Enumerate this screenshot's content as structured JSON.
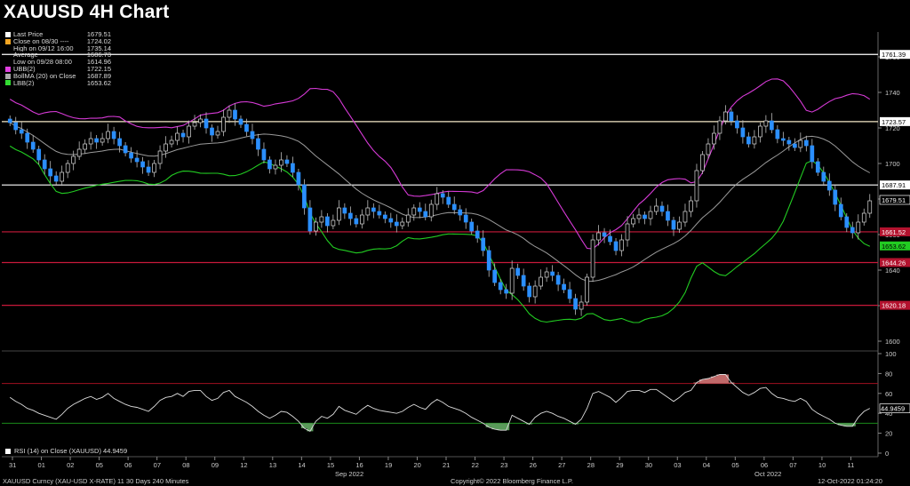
{
  "title": "XAUUSD 4H Chart",
  "legend": [
    {
      "label": "Last Price",
      "value": "1679.51",
      "color": "#ffffff"
    },
    {
      "label": "Close on 08/30 ----",
      "value": "1724.02",
      "color": "#f5a623"
    },
    {
      "label": "High on 09/12 16:00",
      "value": "1735.14",
      "color": ""
    },
    {
      "label": "Average",
      "value": "1686.73",
      "color": ""
    },
    {
      "label": "Low on 09/28 08:00",
      "value": "1614.96",
      "color": ""
    },
    {
      "label": "UBB(2)",
      "value": "1722.15",
      "color": "#e040e0"
    },
    {
      "label": "BollMA (20)  on Close",
      "value": "1687.89",
      "color": "#aaaaaa"
    },
    {
      "label": "LBB(2)",
      "value": "1653.62",
      "color": "#33dd33"
    }
  ],
  "rsi_legend": "RSI (14)  on Close (XAUUSD) 44.9459",
  "footer": {
    "left": "XAUUSD Curncy (XAU-USD X-RATE) 11 30 Days 240 Minutes",
    "center": "Copyright© 2022 Bloomberg Finance L.P.",
    "right": "12-Oct-2022 01:24:20"
  },
  "chart_data": {
    "type": "candlestick",
    "price_axis": {
      "range": [
        1596,
        1770
      ],
      "ticks": [
        "1760",
        "1740",
        "1720",
        "1700",
        "1680",
        "1660",
        "1640",
        "1620",
        "1600"
      ]
    },
    "rsi_axis": {
      "range": [
        0,
        100
      ],
      "ticks": [
        "100",
        "80",
        "60",
        "40",
        "20",
        "0"
      ],
      "overbought": 70,
      "oversold": 30
    },
    "x_ticks": [
      "31",
      "01",
      "02",
      "05",
      "06",
      "07",
      "08",
      "09",
      "12",
      "13",
      "14",
      "15",
      "16",
      "19",
      "20",
      "21",
      "22",
      "23",
      "26",
      "27",
      "28",
      "29",
      "30",
      "03",
      "04",
      "05",
      "06",
      "07",
      "10",
      "11"
    ],
    "x_months": [
      "Sep 2022",
      "Oct 2022"
    ],
    "horizontal_levels": [
      {
        "value": 1761.39,
        "label": "1761.39",
        "color": "#ffffff",
        "text": "#000000",
        "line": "#ffffff"
      },
      {
        "value": 1723.57,
        "label": "1723.57",
        "color": "#ffffff",
        "text": "#000000",
        "line": "#f5e9c8"
      },
      {
        "value": 1687.91,
        "label": "1687.91",
        "color": "#ffffff",
        "text": "#000000",
        "line": "#ffffff"
      },
      {
        "value": 1661.52,
        "label": "1661.52",
        "color": "#b3122e",
        "text": "#ffffff",
        "line": "#c8193a"
      },
      {
        "value": 1644.26,
        "label": "1644.26",
        "color": "#b3122e",
        "text": "#ffffff",
        "line": "#c8193a"
      },
      {
        "value": 1620.18,
        "label": "1620.18",
        "color": "#b3122e",
        "text": "#ffffff",
        "line": "#c8193a"
      }
    ],
    "last_price": {
      "value": 1679.51,
      "label": "1679.51"
    },
    "lbb_last": {
      "value": 1653.62,
      "label": "1653.62"
    },
    "rsi_last": {
      "value": 44.9459,
      "label": "44.9459"
    },
    "close": [
      1723,
      1719,
      1717,
      1712,
      1708,
      1702,
      1697,
      1693,
      1690,
      1695,
      1700,
      1704,
      1708,
      1711,
      1714,
      1712,
      1714,
      1718,
      1714,
      1710,
      1706,
      1703,
      1701,
      1698,
      1695,
      1700,
      1707,
      1711,
      1713,
      1717,
      1715,
      1721,
      1723,
      1725,
      1720,
      1716,
      1718,
      1726,
      1730,
      1725,
      1722,
      1718,
      1714,
      1708,
      1702,
      1697,
      1699,
      1702,
      1700,
      1695,
      1688,
      1675,
      1662,
      1667,
      1670,
      1665,
      1668,
      1675,
      1672,
      1669,
      1666,
      1671,
      1675,
      1673,
      1671,
      1669,
      1667,
      1665,
      1667,
      1671,
      1675,
      1673,
      1670,
      1677,
      1683,
      1681,
      1677,
      1674,
      1671,
      1667,
      1662,
      1658,
      1651,
      1640,
      1633,
      1629,
      1627,
      1641,
      1637,
      1631,
      1625,
      1631,
      1636,
      1639,
      1637,
      1632,
      1629,
      1624,
      1618,
      1622,
      1636,
      1657,
      1661,
      1659,
      1656,
      1651,
      1657,
      1666,
      1669,
      1671,
      1669,
      1673,
      1676,
      1673,
      1668,
      1663,
      1667,
      1673,
      1679,
      1696,
      1705,
      1711,
      1717,
      1724,
      1729,
      1724,
      1720,
      1715,
      1711,
      1715,
      1721,
      1724,
      1719,
      1714,
      1713,
      1711,
      1709,
      1713,
      1710,
      1701,
      1695,
      1690,
      1685,
      1677,
      1670,
      1664,
      1661,
      1667,
      1672,
      1679
    ],
    "rsi": [
      56,
      52,
      49,
      45,
      43,
      40,
      38,
      36,
      34,
      39,
      45,
      49,
      52,
      55,
      57,
      54,
      56,
      60,
      55,
      52,
      49,
      47,
      46,
      44,
      42,
      47,
      53,
      56,
      57,
      60,
      57,
      62,
      63,
      63,
      57,
      53,
      55,
      61,
      63,
      57,
      54,
      51,
      47,
      42,
      38,
      35,
      38,
      42,
      41,
      37,
      32,
      25,
      22,
      32,
      37,
      35,
      39,
      47,
      43,
      41,
      39,
      44,
      48,
      45,
      43,
      42,
      41,
      40,
      42,
      46,
      49,
      46,
      44,
      50,
      54,
      51,
      47,
      45,
      43,
      40,
      36,
      33,
      30,
      26,
      24,
      23,
      23,
      38,
      35,
      32,
      29,
      36,
      40,
      42,
      40,
      37,
      35,
      32,
      29,
      34,
      45,
      60,
      62,
      59,
      56,
      51,
      56,
      62,
      63,
      63,
      61,
      64,
      64,
      60,
      56,
      52,
      56,
      61,
      63,
      71,
      74,
      75,
      77,
      79,
      79,
      71,
      66,
      61,
      58,
      61,
      65,
      66,
      60,
      56,
      55,
      53,
      52,
      55,
      52,
      44,
      40,
      37,
      34,
      30,
      28,
      27,
      27,
      36,
      42,
      45
    ]
  }
}
